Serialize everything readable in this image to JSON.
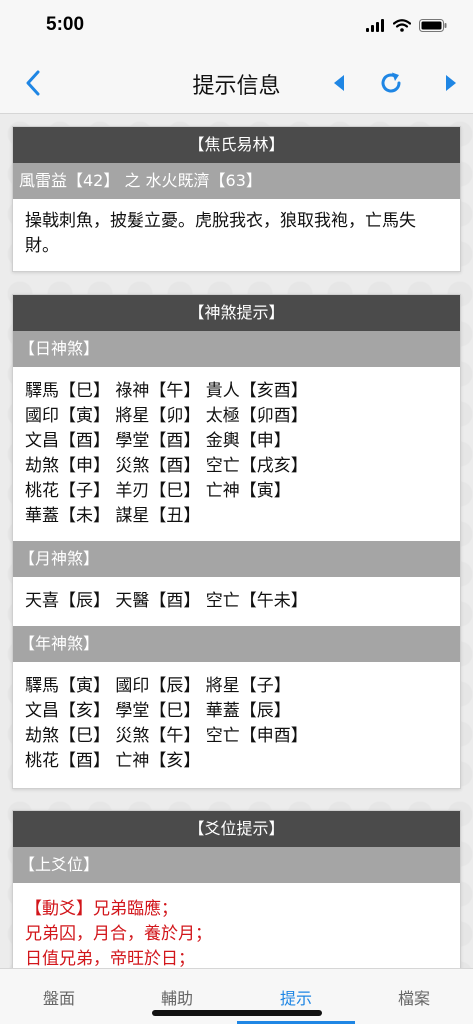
{
  "status": {
    "time": "5:00"
  },
  "nav": {
    "title": "提示信息"
  },
  "cards": {
    "jiaoshi": {
      "header": "【焦氏易林】",
      "subheader": "風雷益【42】 之 水火既濟【63】",
      "text": "操戟刺魚，披髮立憂。虎脫我衣，狼取我袍，亡馬失財。"
    },
    "shensha": {
      "header": "【神煞提示】",
      "day_title": "【日神煞】",
      "day_rows": [
        "驛馬【巳】 祿神【午】 貴人【亥酉】",
        "國印【寅】 將星【卯】 太極【卯酉】",
        "文昌【酉】 學堂【酉】 金輿【申】",
        "劫煞【申】 災煞【酉】 空亡【戌亥】",
        "桃花【子】 羊刃【巳】 亡神【寅】",
        "華蓋【未】 謀星【丑】"
      ],
      "month_title": "【月神煞】",
      "month_rows": [
        "天喜【辰】 天醫【酉】 空亡【午未】"
      ],
      "year_title": "【年神煞】",
      "year_rows": [
        "驛馬【寅】 國印【辰】 將星【子】",
        "文昌【亥】 學堂【巳】 華蓋【辰】",
        "劫煞【巳】 災煞【午】 空亡【申酉】",
        "桃花【酉】 亡神【亥】"
      ]
    },
    "yaowei": {
      "header": "【爻位提示】",
      "section_title": "【上爻位】",
      "lines": [
        "【動爻】兄弟臨應；",
        "兄弟囚，月合，養於月；",
        "日值兄弟，帝旺於日；"
      ]
    }
  },
  "tabs": [
    {
      "label": "盤面"
    },
    {
      "label": "輔助"
    },
    {
      "label": "提示"
    },
    {
      "label": "檔案"
    }
  ],
  "colors": {
    "accent": "#1f86e4",
    "card_header": "#4b4b4b",
    "section_header": "#a5a5a5",
    "highlight_text": "#d2161b"
  }
}
